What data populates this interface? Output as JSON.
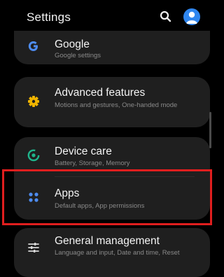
{
  "header": {
    "title": "Settings"
  },
  "icons": {
    "search": "search-icon",
    "account": "account-icon",
    "google": "google-icon",
    "advanced": "gear-icon",
    "device_care": "device-care-icon",
    "apps": "apps-grid-icon",
    "general": "sliders-icon"
  },
  "colors": {
    "background": "#000000",
    "card": "#1f1f1f",
    "accent_blue": "#2f86ef",
    "advanced_icon": "#f0b400",
    "device_care_icon": "#1fb58c",
    "apps_icon": "#4e8cf0",
    "highlight_box": "#e01e1e"
  },
  "items": [
    {
      "title": "Google",
      "subtitle": "Google settings"
    },
    {
      "title": "Advanced features",
      "subtitle": "Motions and gestures, One-handed mode"
    },
    {
      "title": "Device care",
      "subtitle": "Battery, Storage, Memory"
    },
    {
      "title": "Apps",
      "subtitle": "Default apps, App permissions"
    },
    {
      "title": "General management",
      "subtitle": "Language and input, Date and time, Reset"
    }
  ]
}
